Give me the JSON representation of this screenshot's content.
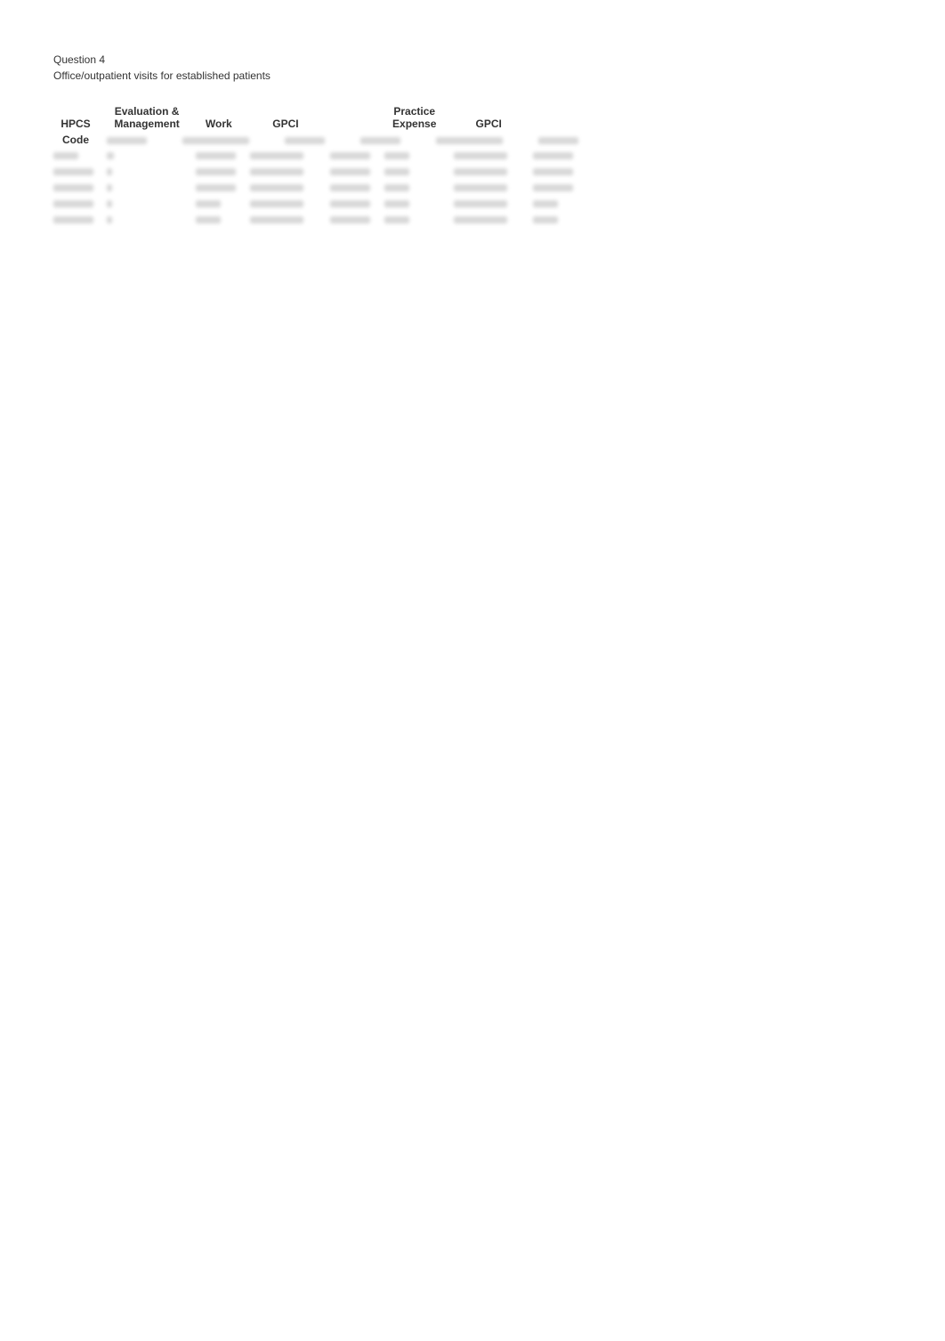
{
  "page": {
    "question_label": "Question 4",
    "question_description": "Office/outpatient visits for established patients",
    "table": {
      "header_row1": {
        "col1": "",
        "col2": "Evaluation &",
        "col3": "",
        "col4": "",
        "col5": "",
        "col6": "Practice",
        "col7": "",
        "col8": ""
      },
      "header_row2": {
        "col1": "HPCS",
        "col2": "Management",
        "col3": "Work",
        "col4": "GPCI",
        "col5": "",
        "col6": "Expense",
        "col7": "GPCI",
        "col8": ""
      },
      "header_row3": {
        "col1": "Code",
        "col2": "",
        "col3": "",
        "col4": "",
        "col5": "",
        "col6": "",
        "col7": "",
        "col8": ""
      }
    }
  }
}
